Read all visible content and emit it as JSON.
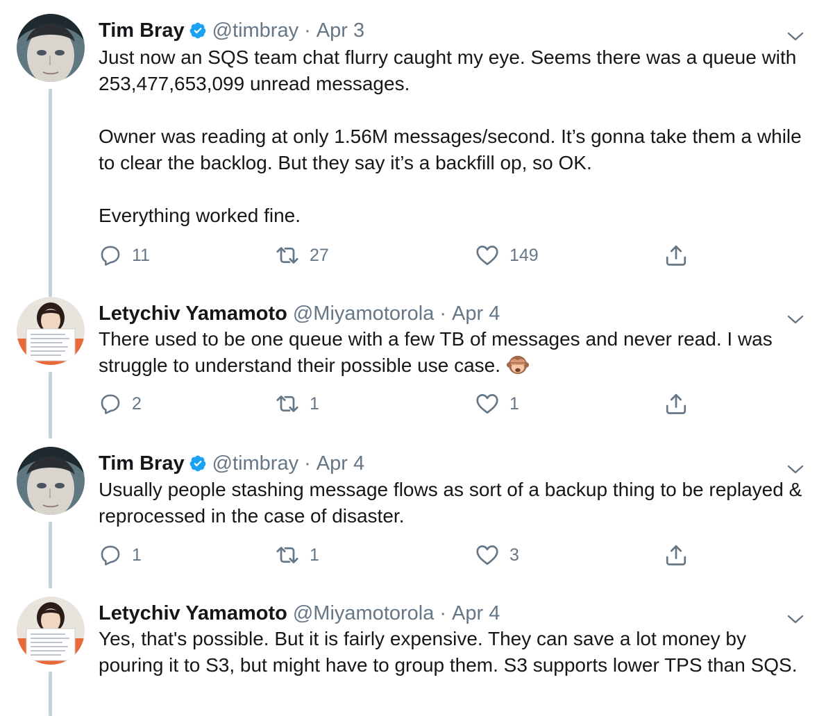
{
  "tweets": [
    {
      "name": "Tim Bray",
      "verified": true,
      "handle": "@timbray",
      "separator": "·",
      "date": "Apr 3",
      "paragraphs": [
        "Just now an SQS team chat flurry caught my eye. Seems there was a queue with 253,477,653,099 unread messages.",
        "Owner was reading at only 1.56M messages/second.  It’s gonna take them a while to clear the backlog.  But they say it’s a backfill op, so OK.",
        "Everything worked fine."
      ],
      "replies": "11",
      "retweets": "27",
      "likes": "149"
    },
    {
      "name": "Letychiv Yamamoto",
      "verified": false,
      "handle": "@Miyamotorola",
      "separator": "·",
      "date": "Apr 4",
      "paragraphs": [
        "There used to be one queue with a few TB of messages and never read. I was struggle to understand their possible use case."
      ],
      "emoji": "see-no-evil-monkey-icon",
      "replies": "2",
      "retweets": "1",
      "likes": "1"
    },
    {
      "name": "Tim Bray",
      "verified": true,
      "handle": "@timbray",
      "separator": "·",
      "date": "Apr 4",
      "paragraphs": [
        "Usually people stashing message flows as sort of a backup thing to be replayed & reprocessed in the case of disaster."
      ],
      "replies": "1",
      "retweets": "1",
      "likes": "3"
    },
    {
      "name": "Letychiv Yamamoto",
      "verified": false,
      "handle": "@Miyamotorola",
      "separator": "·",
      "date": "Apr 4",
      "paragraphs": [
        "Yes, that's possible. But it is fairly expensive. They can save a lot money by pouring it to S3, but might have to group them. S3 supports lower TPS than SQS."
      ]
    }
  ],
  "colors": {
    "text": "#14171a",
    "secondary": "#657786",
    "verified": "#1da1f2",
    "thread_line": "#c4cfd6"
  }
}
